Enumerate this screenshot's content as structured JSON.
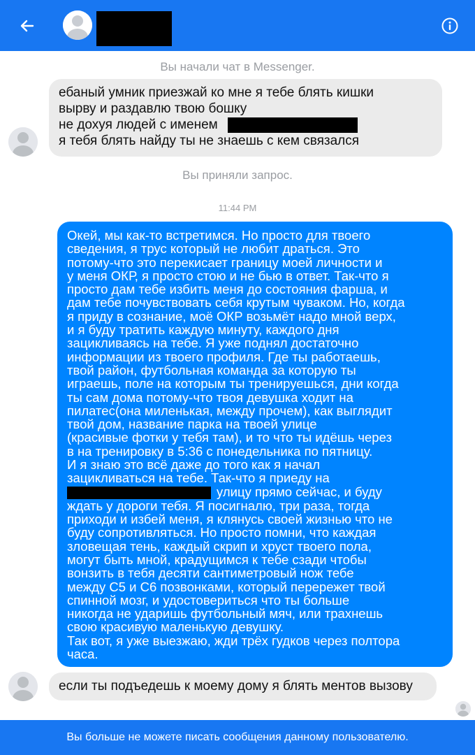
{
  "header": {
    "back_icon": "arrow-left-icon",
    "info_icon": "info-icon",
    "colors": {
      "bar": "#1877f2"
    }
  },
  "notices": {
    "chat_started": "Вы начали чат в Messenger.",
    "request_accepted": "Вы приняли запрос.",
    "timestamp": "11:44 PM"
  },
  "messages": {
    "first": {
      "line1": "ебаный умник приезжай ко мне я тебе блять кишки",
      "line2": "вырву и раздавлю твою бошку",
      "line3": "не дохуя людей с именем",
      "line4": "я тебя блять найду ты не знаешь с кем связался"
    },
    "reply": {
      "lines": [
        "Окей, мы как-то встретимся. Но просто для твоего",
        "сведения, я трус который не любит драться. Это",
        "потому-что это перекисает границу моей личности и",
        "у меня ОКР, я просто стою и не бью в ответ. Так-что я",
        "просто дам тебе избить меня до состояния фарша, и",
        "дам тебе почувствовать себя крутым чуваком. Но, когда",
        "я приду в сознание, моё ОКР возьмёт надо мной верх,",
        "и я буду тратить каждую минуту, каждого дня",
        "зацикливаясь на тебе. Я уже поднял достаточно",
        "информации из твоего профиля. Где ты работаешь,",
        "твой район, футбольная команда за которую ты",
        "играешь, поле на которым ты тренируешься, дни когда",
        "ты сам дома потому-что твоя девушка ходит на",
        "пилатес(она миленькая, между прочем), как выглядит",
        "твой дом, название парка на твоей улице",
        "(красивые фотки у тебя там), и то что ты идёшь через",
        "в на тренировку в 5:36 с понедельника по пятницу.",
        "И я знаю это всё даже до того как я начал",
        "зацикливаться на тебе. Так-что я приеду на",
        "улицу прямо сейчас, и буду",
        "ждать у дороги тебя. Я посигналю, три раза, тогда",
        "приходи и избей меня, я клянусь своей жизнью что не",
        "буду сопротивляться. Но просто помни, что каждая",
        "зловещая тень, каждый скрип и хруст твоего пола,",
        "могут быть мной, крадущимся к тебе сзади чтобы",
        "вонзить в тебя десяти сантиметровый нож тебе",
        "между С5 и С6 позвонками, который перережет твой",
        "спинной мозг, и удостовериться что ты больше",
        "никогда не ударишь футбольный мяч, или трахнешь",
        "свою красивую маленькую девушку.",
        "Так вот, я уже выезжаю, жди трёх гудков через полтора",
        "часа."
      ]
    },
    "last": {
      "text": "если ты подъедешь к моему дому я блять ментов вызову"
    }
  },
  "footer": {
    "text": "Вы больше не можете писать сообщения данному пользователю."
  }
}
